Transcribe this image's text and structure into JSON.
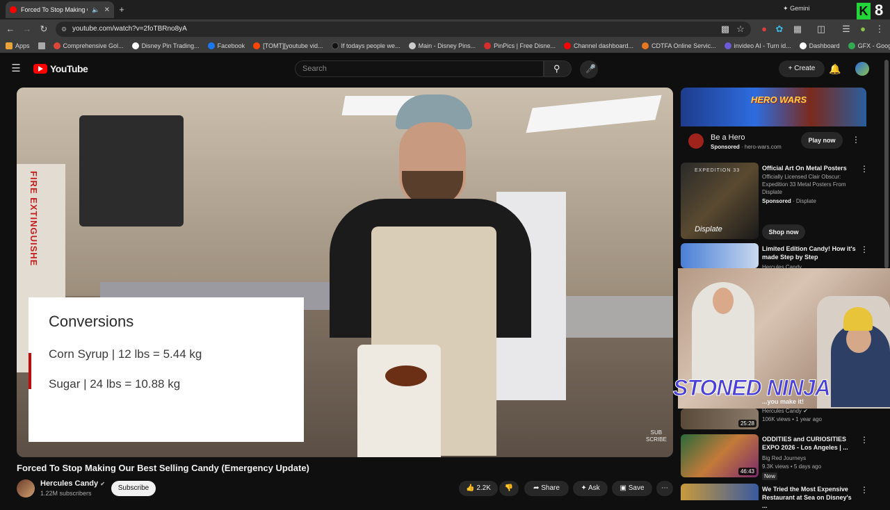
{
  "browser": {
    "tab_title": "Forced To Stop Making Our",
    "url": "youtube.com/watch?v=2foTBRno8yA",
    "gemini_label": "Gemini",
    "corner_badge": "8",
    "bookmarks": [
      {
        "label": "Apps",
        "color": "#bbbbbb"
      },
      {
        "label": "Comprehensive Gol...",
        "color": "#e0453a"
      },
      {
        "label": "Disney Pin Trading...",
        "color": "#ffffff"
      },
      {
        "label": "Facebook",
        "color": "#1877f2"
      },
      {
        "label": "[TOMT][youtube vid...",
        "color": "#ff4500"
      },
      {
        "label": "If todays people we...",
        "color": "#000000"
      },
      {
        "label": "Main - Disney Pins...",
        "color": "#cccccc"
      },
      {
        "label": "PinPics | Free Disne...",
        "color": "#d62d2d"
      },
      {
        "label": "Channel dashboard...",
        "color": "#ff0000"
      },
      {
        "label": "CDTFA Online Servic...",
        "color": "#e87722"
      },
      {
        "label": "invideo AI - Turn id...",
        "color": "#6b5bd6"
      },
      {
        "label": "Dashboard",
        "color": "#ffffff"
      },
      {
        "label": "GFX - Google Drive",
        "color": "#34a853"
      }
    ]
  },
  "youtube": {
    "logo_text": "YouTube",
    "search_placeholder": "Search",
    "create_label": "Create",
    "video": {
      "title": "Forced To Stop Making Our Best Selling Candy (Emergency Update)",
      "overlay_heading": "Conversions",
      "overlay_rows": [
        "Corn Syrup | 12 lbs = 5.44 kg",
        "Sugar | 24 lbs = 10.88 kg"
      ],
      "sign_text": "FIRE EXTINGUISHE",
      "subscribe_watermark": [
        "SUB",
        "SCRIBE"
      ]
    },
    "channel": {
      "name": "Hercules Candy",
      "subscribers": "1.22M subscribers",
      "subscribe_label": "Subscribe"
    },
    "actions": {
      "likes": "2.2K",
      "share": "Share",
      "ask": "Ask",
      "save": "Save"
    },
    "sidebar": {
      "ad": {
        "logo": "HERO WARS",
        "title": "Be a Hero",
        "sponsored": "Sponsored",
        "domain": "hero-wars.com",
        "cta": "Play now"
      },
      "ad2": {
        "title": "Official Art On Metal Posters",
        "description": "Officially Licensed Clair Obscur: Expedition 33 Metal Posters From Displate",
        "sponsored": "Sponsored",
        "advertiser": "Displate",
        "cta": "Shop now",
        "thumb_brand": "Displate",
        "thumb_caption": "EXPEDITION 33"
      },
      "videos": [
        {
          "title": "Limited Edition Candy! How it's made Step by Step",
          "channel": "Hercules Candy",
          "meta": ""
        },
        {
          "title": "...you make it!",
          "channel": "Hercules Candy",
          "meta": "106K views • 1 year ago",
          "duration": "25:28"
        },
        {
          "title": "ODDITIES and CURIOSITIES EXPO 2026 - Los Angeles | ...",
          "channel": "Big Red Journeys",
          "meta": "9.3K views • 5 days ago",
          "badge": "New",
          "duration": "46:43"
        },
        {
          "title": "We Tried the Most Expensive Restaurant at Sea on Disney's ...",
          "channel": "",
          "meta": ""
        }
      ]
    },
    "stream_overlay": {
      "text": "STONED NINJA"
    }
  }
}
